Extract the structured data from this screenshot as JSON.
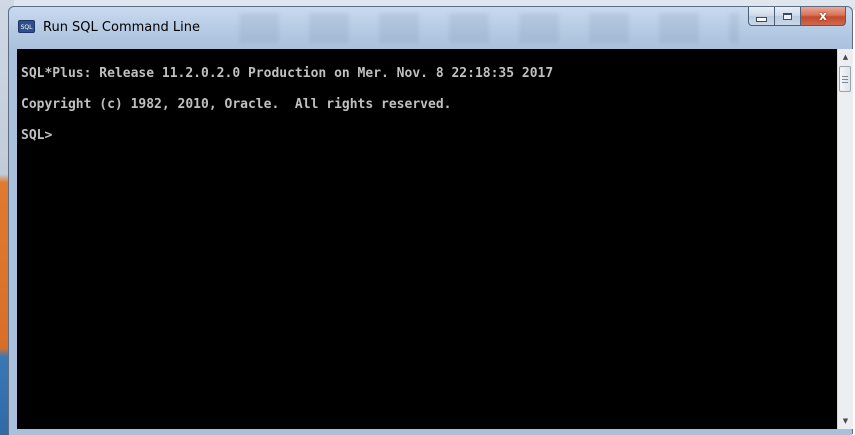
{
  "window": {
    "title": "Run SQL Command Line",
    "icon": "sqlplus-app-icon",
    "icon_label": "SQL",
    "controls": {
      "minimize": "minimize-icon",
      "maximize": "maximize-icon",
      "close_glyph": "x"
    }
  },
  "console": {
    "lines": [
      "SQL*Plus: Release 11.2.0.2.0 Production on Mer. Nov. 8 22:18:35 2017",
      "Copyright (c) 1982, 2010, Oracle.  All rights reserved.",
      "SQL>"
    ],
    "text_color": "#c0c0c0",
    "background_color": "#000000"
  },
  "scrollbar": {
    "up_arrow": "▲",
    "down_arrow": "▼"
  }
}
